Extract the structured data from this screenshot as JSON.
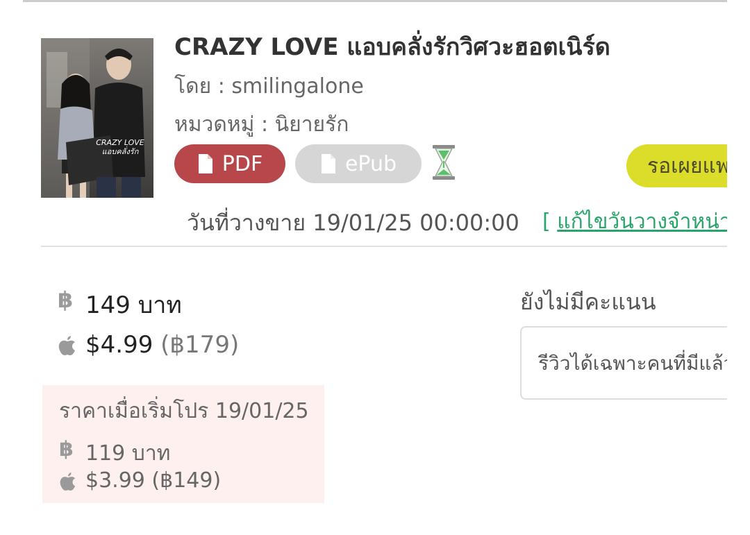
{
  "book": {
    "title": "CRAZY LOVE แอบคลั่งรักวิศวะฮอตเนิร์ด",
    "author_line": "โดย : smilingalone",
    "category_line": "หมวดหมู่ : นิยายรัก",
    "cover_text": "CRAZY LOVE แอบคลั่งรัก",
    "formats": [
      {
        "label": "PDF",
        "icon": "file-icon",
        "color": "#b7474a"
      },
      {
        "label": "ePub",
        "icon": "file-icon",
        "color": "#d6d6d6"
      }
    ],
    "pending_icon": "hourglass-icon",
    "status_badge": "รอเผยแพร่",
    "release_text": "วันที่วางขาย 19/01/25 00:00:00",
    "edit_link_bracket": "[",
    "edit_link": "แก้ไขวันวางจำหน่าย"
  },
  "prices": {
    "thb_icon": "฿",
    "thb_price": "149 บาท",
    "apple_icon": "apple-icon",
    "usd_price": "$4.99",
    "usd_price_thb": "(฿179)"
  },
  "promo": {
    "title": "ราคาเมื่อเริ่มโปร 19/01/25",
    "thb_price": "119 บาท",
    "usd_price": "$3.99 (฿149)",
    "background": "#fdf0ef"
  },
  "rating": {
    "label": "ยังไม่มีคะแนน",
    "review_placeholder": "รีวิวได้เฉพาะคนที่มีแล้วเท่านั้น"
  },
  "colors": {
    "pdf": "#b7474a",
    "epub": "#d6d6d6",
    "status": "#dcdc2a",
    "link": "#2aa56a"
  }
}
